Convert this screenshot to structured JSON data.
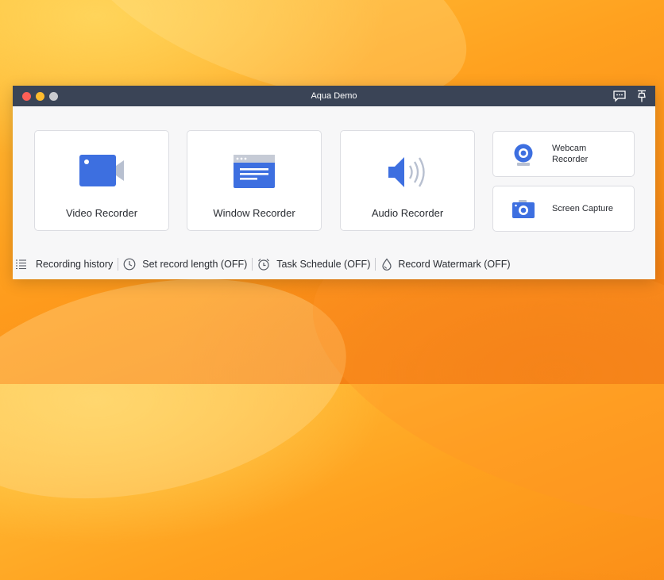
{
  "window": {
    "title": "Aqua Demo"
  },
  "cards": {
    "video": "Video Recorder",
    "window": "Window Recorder",
    "audio": "Audio Recorder",
    "webcam_line1": "Webcam",
    "webcam_line2": "Recorder",
    "screen_capture": "Screen Capture"
  },
  "bottom_bar": {
    "history": "Recording history",
    "record_length": "Set record length (OFF)",
    "task_schedule": "Task Schedule (OFF)",
    "watermark": "Record Watermark (OFF)"
  },
  "colors": {
    "accent": "#3d6fe0",
    "titlebar": "#3a4456"
  },
  "icons": [
    "chat-icon",
    "pin-icon",
    "video-camera-icon",
    "window-icon",
    "speaker-icon",
    "webcam-icon",
    "camera-icon",
    "list-icon",
    "clock-icon",
    "alarm-icon",
    "watermark-icon"
  ]
}
